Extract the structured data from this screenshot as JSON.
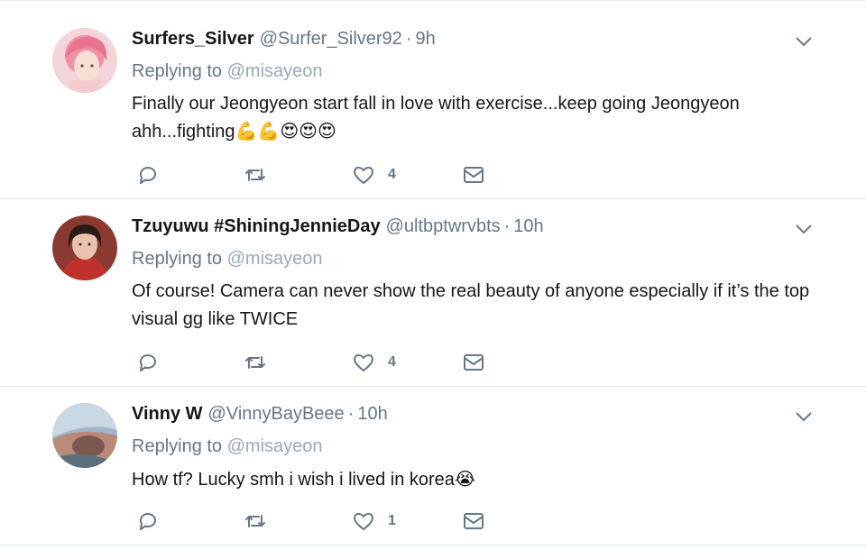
{
  "tweets": [
    {
      "display_name": "Surfers_Silver",
      "handle": "@Surfer_Silver92",
      "separator": "·",
      "time": "9h",
      "replying_label": "Replying to",
      "replying_to": "@misayeon",
      "text": "Finally our Jeongyeon start fall in love with exercise...keep going Jeongyeon ahh...fighting",
      "emoji": "💪💪😍😍😍",
      "like_count": "4",
      "avatar_icon": "pink-hair-avatar"
    },
    {
      "display_name": "Tzuyuwu #ShiningJennieDay",
      "handle": "@ultbptwrvbts",
      "separator": "·",
      "time": "10h",
      "replying_label": "Replying to",
      "replying_to": "@misayeon",
      "text": "Of course! Camera can never show the real beauty of anyone especially if it’s the top visual gg like TWICE",
      "emoji": "",
      "like_count": "4",
      "avatar_icon": "portrait-avatar"
    },
    {
      "display_name": "Vinny W",
      "handle": "@VinnyBayBeee",
      "separator": "·",
      "time": "10h",
      "replying_label": "Replying to",
      "replying_to": "@misayeon",
      "text": "How tf? Lucky smh i wish i lived in korea",
      "emoji": "😭",
      "like_count": "1",
      "avatar_icon": "photo-avatar"
    }
  ],
  "icons": {
    "reply": "reply-icon",
    "retweet": "retweet-icon",
    "like": "heart-icon",
    "dm": "envelope-icon",
    "menu": "chevron-down-icon"
  },
  "colors": {
    "name": "#14171a",
    "secondary": "#657786",
    "mention": "#9aa9b6",
    "icon": "#657786",
    "divider": "#e1e8ed"
  }
}
